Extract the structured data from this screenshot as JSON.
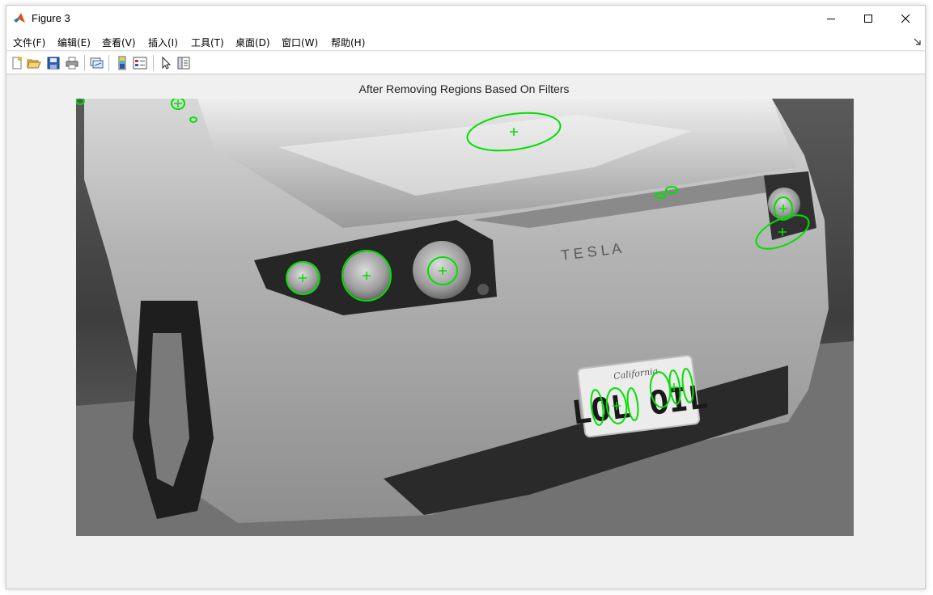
{
  "window": {
    "title": "Figure 3",
    "controls": {
      "minimize": "minimize",
      "maximize": "maximize",
      "close": "close"
    }
  },
  "menu": [
    {
      "label": "文件(F)",
      "key": "file"
    },
    {
      "label": "编辑(E)",
      "key": "edit"
    },
    {
      "label": "查看(V)",
      "key": "view"
    },
    {
      "label": "插入(I)",
      "key": "insert"
    },
    {
      "label": "工具(T)",
      "key": "tools"
    },
    {
      "label": "桌面(D)",
      "key": "desktop"
    },
    {
      "label": "窗口(W)",
      "key": "window"
    },
    {
      "label": "帮助(H)",
      "key": "help"
    }
  ],
  "toolbar": [
    {
      "name": "new-figure-icon"
    },
    {
      "name": "open-file-icon"
    },
    {
      "name": "save-icon"
    },
    {
      "name": "print-icon"
    },
    {
      "name": "link-plot-icon"
    },
    {
      "name": "colorbar-icon"
    },
    {
      "name": "legend-icon"
    },
    {
      "name": "edit-plot-pointer-icon"
    },
    {
      "name": "property-inspector-icon"
    }
  ],
  "figure": {
    "title": "After Removing Regions Based On Filters",
    "image_subject": "grayscale rear view of car with license plate",
    "car_badge_text": "T E S L A",
    "plate_text": "LOL OIL",
    "plate_header": "California",
    "overlay_color": "#00ff00"
  }
}
